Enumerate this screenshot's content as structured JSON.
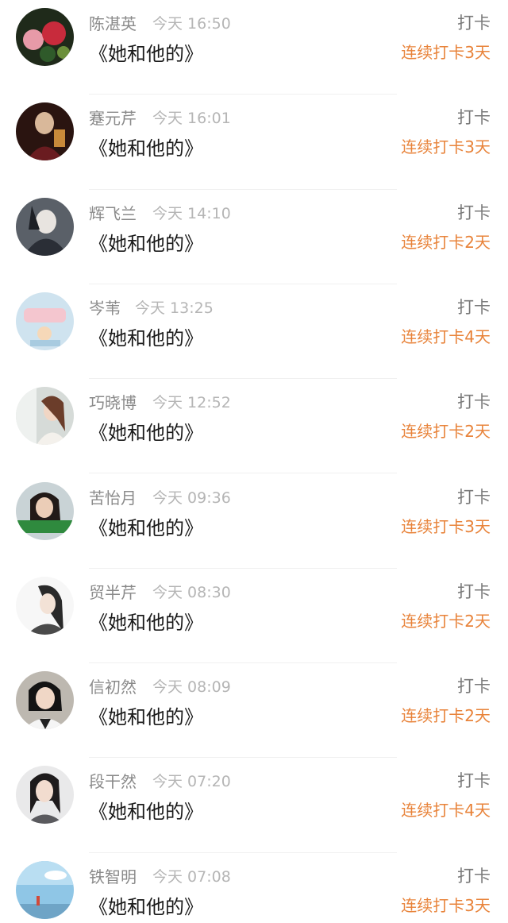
{
  "feed": {
    "items": [
      {
        "name": "陈湛英",
        "time": "今天 16:50",
        "title": "《她和他的》",
        "action": "打卡",
        "streak": "连续打卡3天"
      },
      {
        "name": "蹇元芹",
        "time": "今天 16:01",
        "title": "《她和他的》",
        "action": "打卡",
        "streak": "连续打卡3天"
      },
      {
        "name": "辉飞兰",
        "time": "今天 14:10",
        "title": "《她和他的》",
        "action": "打卡",
        "streak": "连续打卡2天"
      },
      {
        "name": "岑苇",
        "time": "今天 13:25",
        "title": "《她和他的》",
        "action": "打卡",
        "streak": "连续打卡4天"
      },
      {
        "name": "巧晓博",
        "time": "今天 12:52",
        "title": "《她和他的》",
        "action": "打卡",
        "streak": "连续打卡2天"
      },
      {
        "name": "苦怡月",
        "time": "今天 09:36",
        "title": "《她和他的》",
        "action": "打卡",
        "streak": "连续打卡3天"
      },
      {
        "name": "贸半芹",
        "time": "今天 08:30",
        "title": "《她和他的》",
        "action": "打卡",
        "streak": "连续打卡2天"
      },
      {
        "name": "信初然",
        "time": "今天 08:09",
        "title": "《她和他的》",
        "action": "打卡",
        "streak": "连续打卡2天"
      },
      {
        "name": "段干然",
        "time": "今天 07:20",
        "title": "《她和他的》",
        "action": "打卡",
        "streak": "连续打卡4天"
      },
      {
        "name": "铁智明",
        "time": "今天 07:08",
        "title": "《她和他的》",
        "action": "打卡",
        "streak": "连续打卡3天"
      }
    ]
  },
  "colors": {
    "streak": "#e8833a",
    "title": "#1a1a1a",
    "meta": "#8a8a8a"
  }
}
